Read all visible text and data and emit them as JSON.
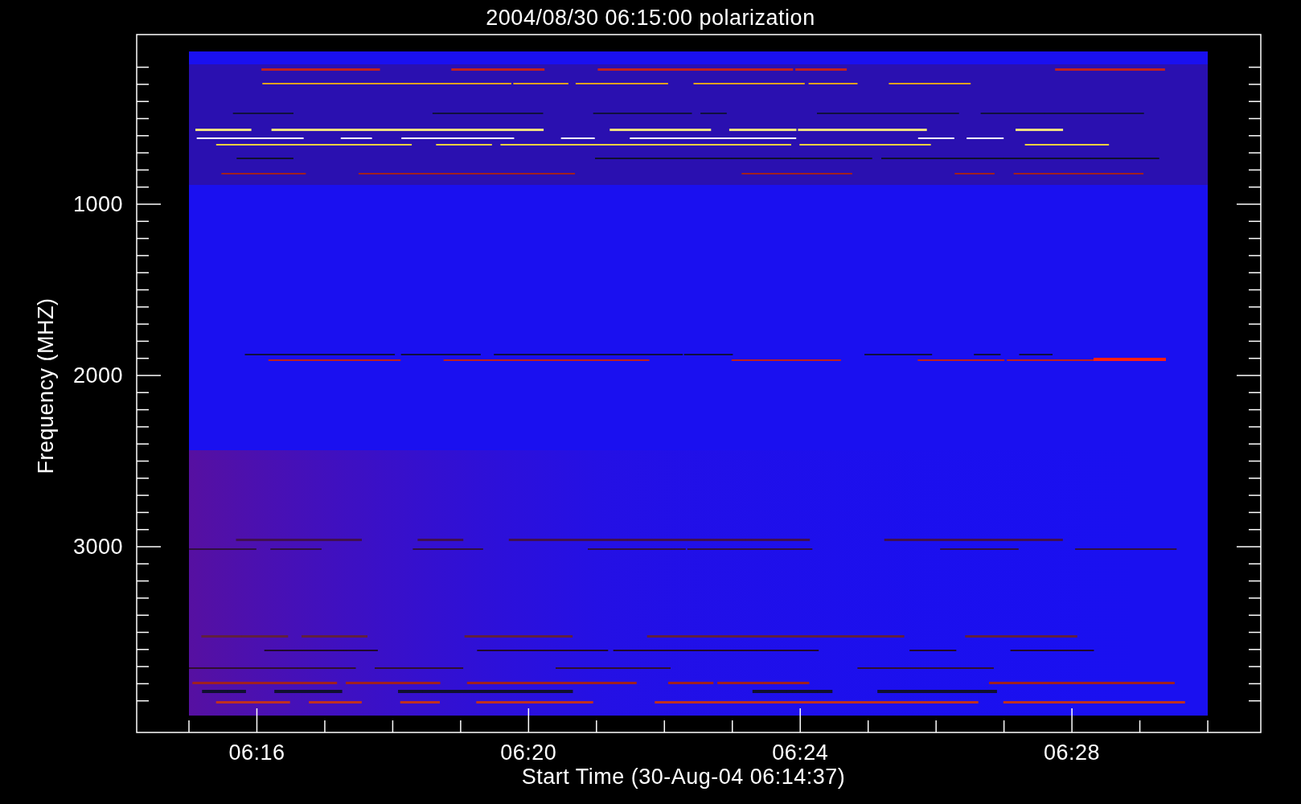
{
  "title": "2004/08/30 06:15:00 polarization",
  "plot": {
    "xlabel": "Start Time (30-Aug-04 06:14:37)",
    "ylabel": "Frequency (MHZ)",
    "xticks": [
      "06:16",
      "06:20",
      "06:24",
      "06:28"
    ],
    "yticks": [
      "1000",
      "2000",
      "3000"
    ]
  }
}
